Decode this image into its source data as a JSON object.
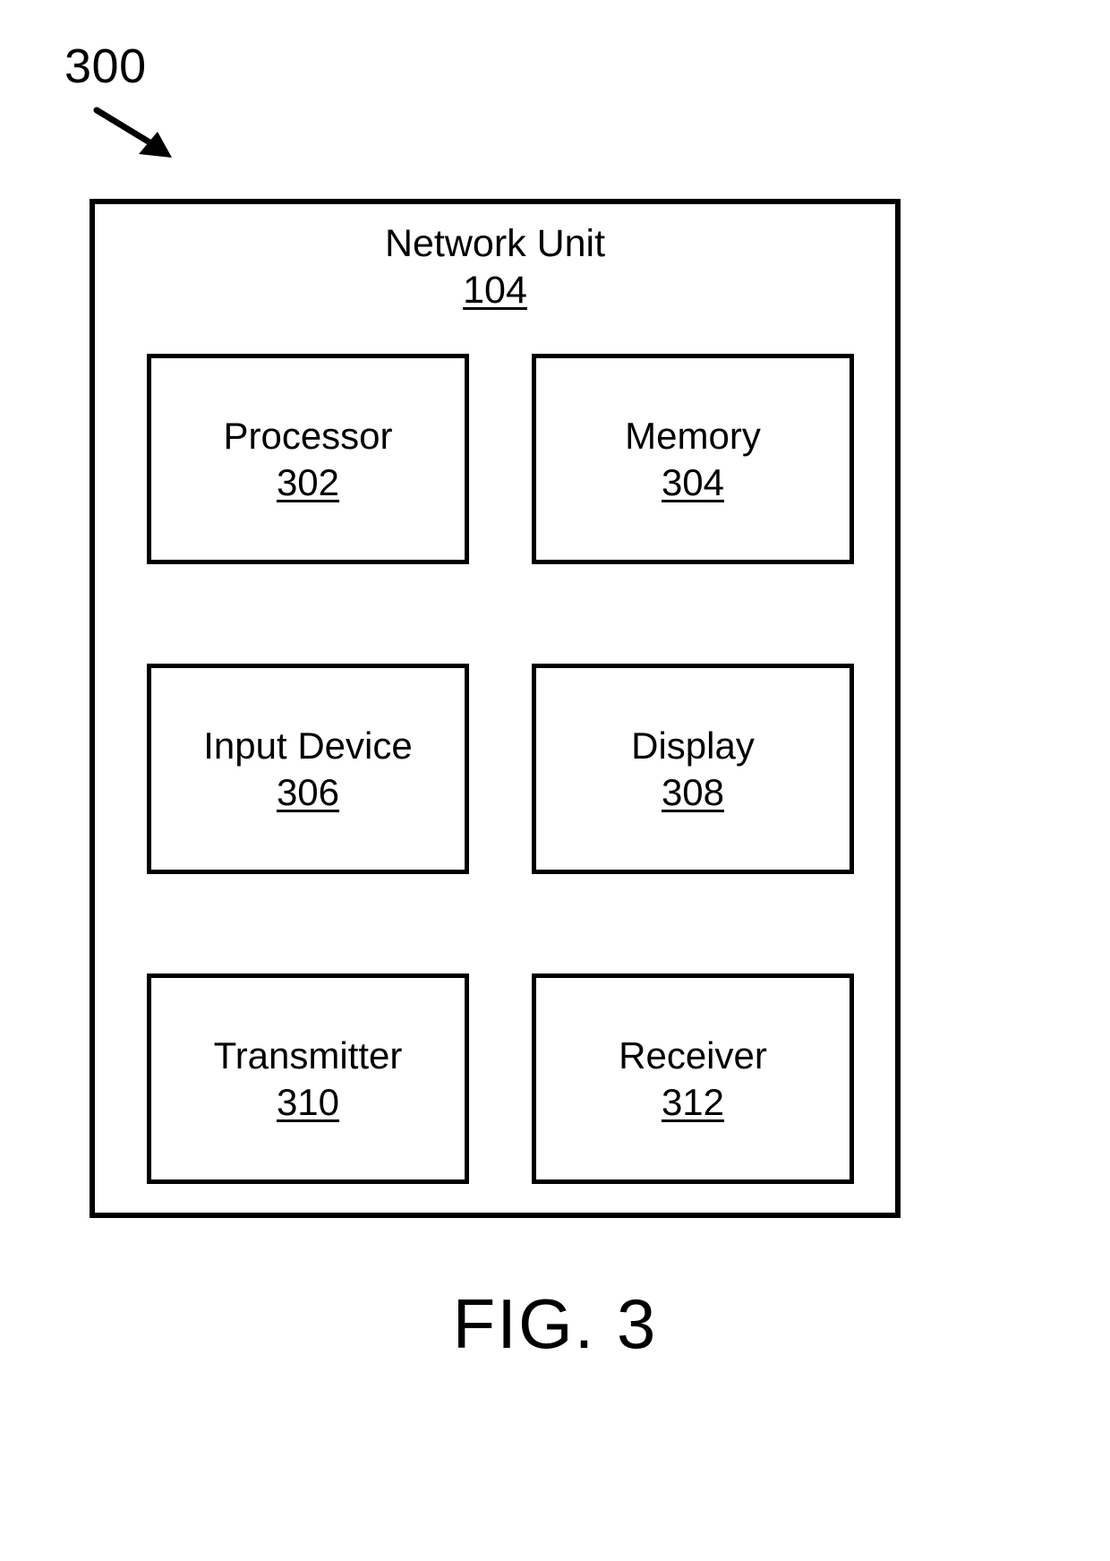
{
  "figure": {
    "reference_numeral": "300",
    "caption": "FIG. 3"
  },
  "network_unit": {
    "title": "Network Unit",
    "ref": "104"
  },
  "components": [
    {
      "title": "Processor",
      "ref": "302"
    },
    {
      "title": "Memory",
      "ref": "304"
    },
    {
      "title": "Input Device",
      "ref": "306"
    },
    {
      "title": "Display",
      "ref": "308"
    },
    {
      "title": "Transmitter",
      "ref": "310"
    },
    {
      "title": "Receiver",
      "ref": "312"
    }
  ],
  "colors": {
    "stroke": "#000000",
    "background": "#ffffff"
  }
}
